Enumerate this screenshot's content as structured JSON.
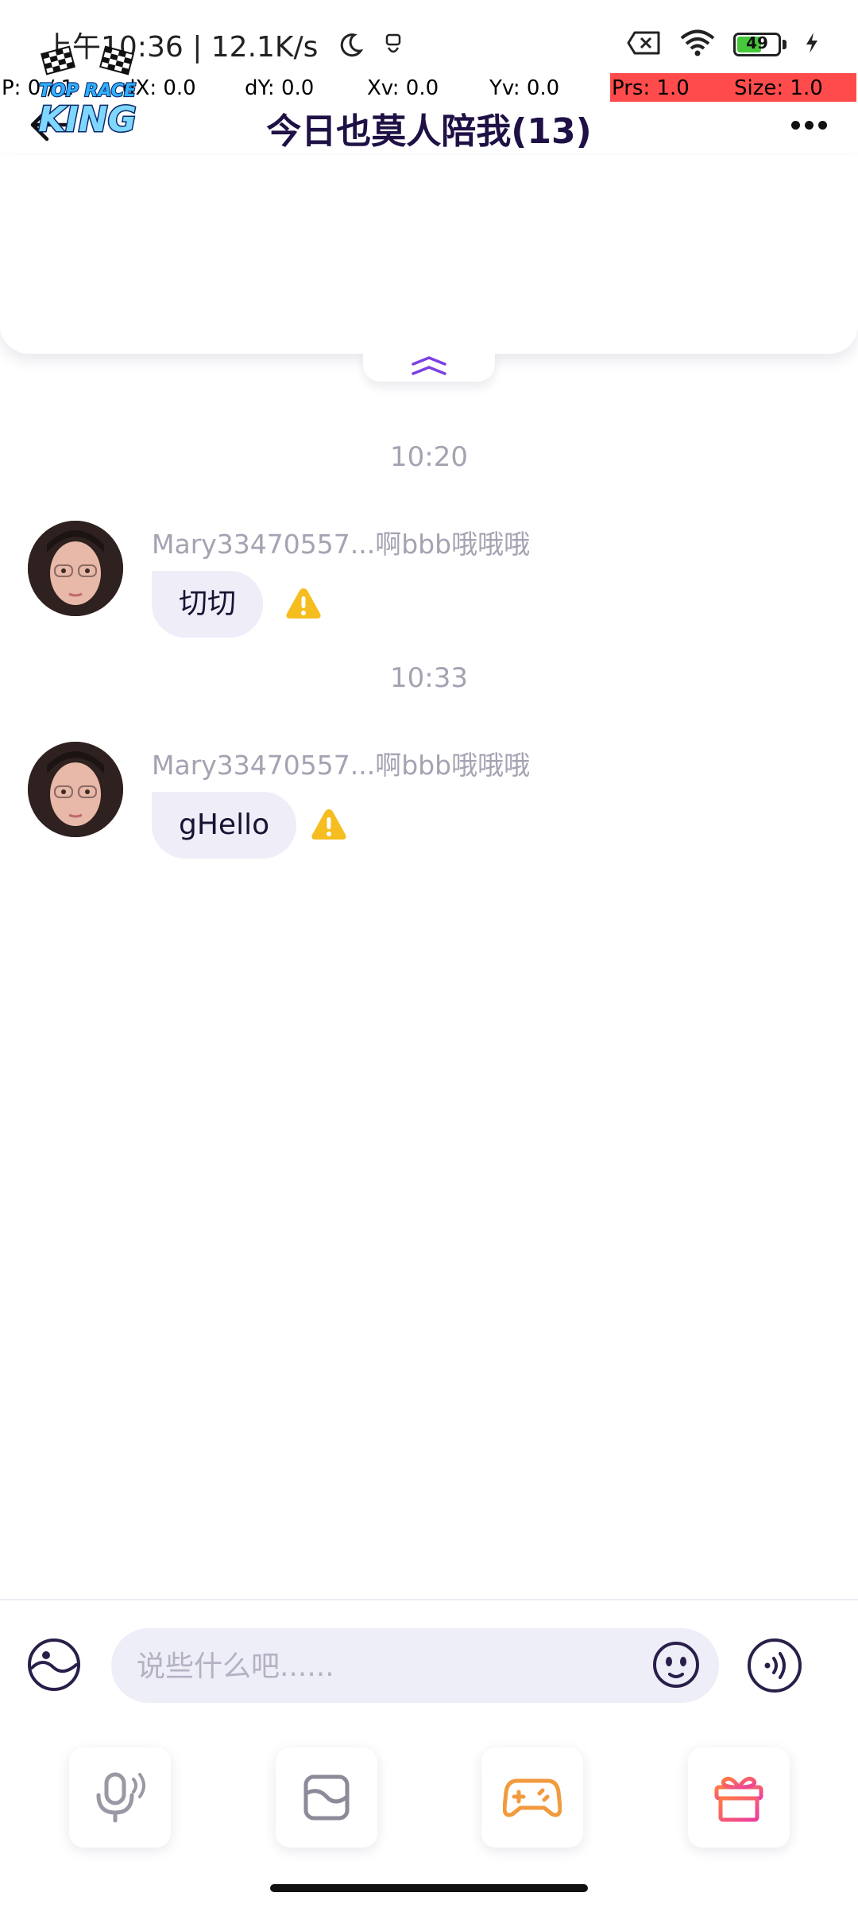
{
  "status_bar": {
    "time_text": "上午10:36 | 12.1K/s",
    "battery_level": "49",
    "icons": [
      "moon-icon",
      "usb-icon",
      "sim-off-icon",
      "wifi-icon",
      "battery-icon",
      "charging-icon"
    ]
  },
  "debug_overlay": {
    "p": "P: 0 / 1",
    "dx": "dX: 0.0",
    "dy": "dY: 0.0",
    "xv": "Xv: 0.0",
    "yv": "Yv: 0.0",
    "prs": "Prs: 1.0",
    "size": "Size: 1.0"
  },
  "header": {
    "title": "今日也莫人陪我(13)",
    "back_icon": "arrow-left-icon",
    "more_icon": "more-dots-icon"
  },
  "banner": {
    "logo_line1": "TOP RACE",
    "logo_line2": "KING",
    "collapse_icon": "chevron-double-up-icon"
  },
  "messages": [
    {
      "time": "10:20",
      "sender": "Mary33470557...啊bbb哦哦哦",
      "text": "切切",
      "status_icon": "warning-icon"
    },
    {
      "time": "10:33",
      "sender": "Mary33470557...啊bbb哦哦哦",
      "text": "gHello",
      "status_icon": "warning-icon"
    }
  ],
  "input": {
    "placeholder": "说些什么吧......",
    "value": ""
  },
  "toolbar": [
    {
      "name": "voice-room",
      "icon": "microphone-icon",
      "color": "#9a98a4"
    },
    {
      "name": "photo",
      "icon": "photo-frame-icon",
      "color": "#8d8a99"
    },
    {
      "name": "game",
      "icon": "gamepad-icon",
      "color": "#f19a3e"
    },
    {
      "name": "gift",
      "icon": "gift-icon",
      "color": "#f0508c"
    }
  ],
  "colors": {
    "accent_purple": "#7b3fe4",
    "warning_yellow": "#f5bd1f",
    "bubble_bg": "#eeedf8",
    "debug_red": "#ff4b4b"
  }
}
